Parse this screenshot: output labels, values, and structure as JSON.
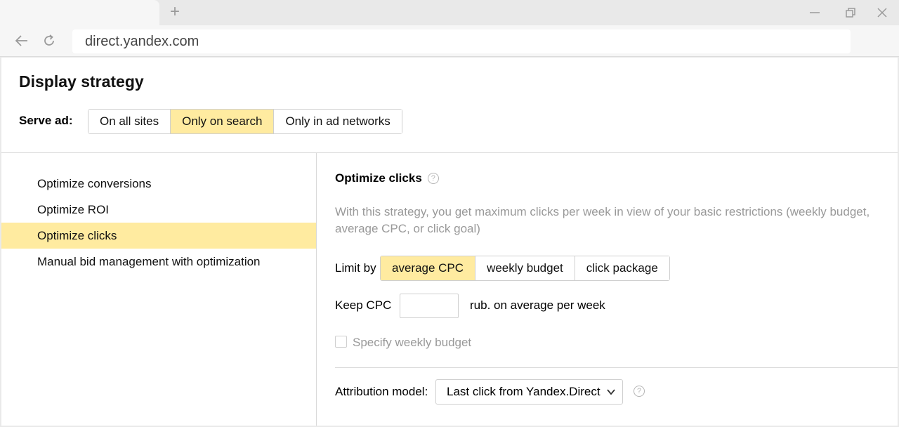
{
  "browser": {
    "new_tab_symbol": "+",
    "url": "direct.yandex.com",
    "icons": [
      "back-arrow-icon",
      "reload-icon",
      "minimize-icon",
      "restore-icon",
      "close-icon"
    ]
  },
  "page": {
    "title": "Display strategy",
    "serve_ad": {
      "label": "Serve ad:",
      "options": [
        "On all sites",
        "Only on search",
        "Only in ad networks"
      ],
      "selected": "Only on search"
    },
    "strategies": [
      "Optimize conversions",
      "Optimize ROI",
      "Optimize clicks",
      "Manual bid management with optimization"
    ],
    "selected_strategy": "Optimize clicks",
    "panel": {
      "title": "Optimize clicks",
      "help_symbol": "?",
      "description": "With this strategy, you get maximum clicks per week in view of your basic restrictions (weekly budget, average CPC, or click goal)",
      "limit_label": "Limit by",
      "limit_options": [
        "average CPC",
        "weekly budget",
        "click package"
      ],
      "limit_selected": "average CPC",
      "keep_cpc_label": "Keep CPC",
      "keep_cpc_value": "",
      "keep_cpc_suffix": "rub. on average per week",
      "weekly_budget_checkbox": "Specify weekly budget",
      "weekly_budget_checked": false,
      "attribution_label": "Attribution model:",
      "attribution_value": "Last click from Yandex.Direct",
      "attribution_help_symbol": "?"
    }
  },
  "colors": {
    "accent_yellow": "#ffeba0",
    "muted_text": "#999999",
    "border": "#cfcfcf"
  }
}
